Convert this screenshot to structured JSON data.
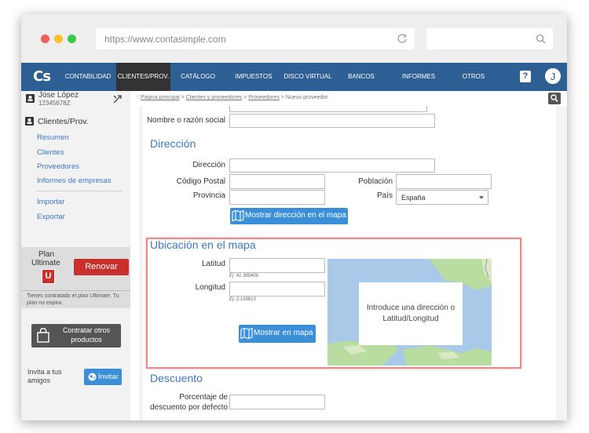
{
  "browser": {
    "url": "https://www.contasimple.com"
  },
  "nav": {
    "logo": "Cs",
    "items": [
      "CONTABILIDAD",
      "CLIENTES/PROV.",
      "CATÁLOGO",
      "IMPUESTOS",
      "DISCO VIRTUAL",
      "BANCOS",
      "INFORMES",
      "OTROS"
    ],
    "active": "CLIENTES/PROV.",
    "help": "?",
    "avatar": "J"
  },
  "sidebar": {
    "user_name": "Jose López",
    "user_id": "12345678Z",
    "section_title": "Clientes/Prov.",
    "links": [
      "Resumen",
      "Clientes",
      "Proveedores",
      "Informes de empresas",
      "Importar",
      "Exportar"
    ],
    "plan_label": "Plan",
    "plan_name": "Ultimate",
    "plan_badge": "U",
    "renew_label": "Renovar",
    "plan_note": "Tienes contratado el plan Ultimate. Tu plan no expira.",
    "contract_label": "Contratar otros productos",
    "invite_text": "Invita a tus amigos",
    "invite_button": "Invitar"
  },
  "breadcrumb": {
    "items": [
      "Página principal",
      "Clientes y proveedores",
      "Proveedores"
    ],
    "current": "Nuevo proveedor"
  },
  "form": {
    "name_label": "Nombre o razón social",
    "address_title": "Dirección",
    "address_label": "Dirección",
    "postal_label": "Código Postal",
    "city_label": "Población",
    "province_label": "Provincia",
    "country_label": "País",
    "country_value": "España",
    "show_address_button": "Mostrar dirección en el mapa",
    "map_title": "Ubicación en el mapa",
    "lat_label": "Latitud",
    "lat_hint": "Ej: 41.389400",
    "lng_label": "Longitud",
    "lng_hint": "Ej: 2.139813",
    "show_map_button": "Mostrar en mapa",
    "map_message": "Introduce una dirección o Latitud/Longitud",
    "discount_title": "Descuento",
    "discount_label": "Porcentaje de descuento por defecto"
  },
  "colors": {
    "navbar": "#2d5f94",
    "accent": "#3a78c2",
    "renew": "#c9302c",
    "highlight": "#e88a8a"
  }
}
